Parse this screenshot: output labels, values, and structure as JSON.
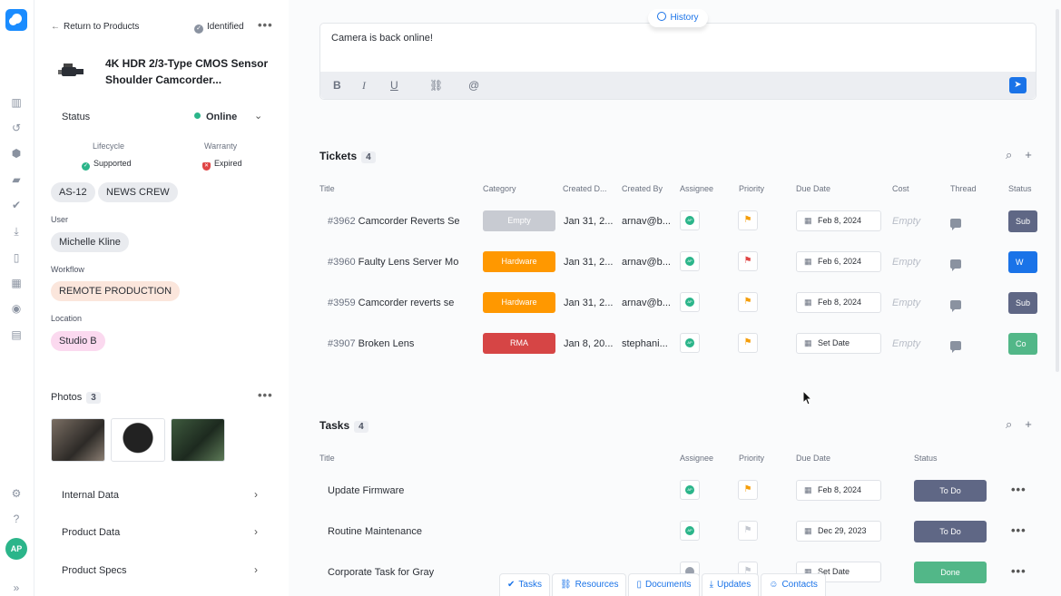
{
  "rail": {
    "avatar": "AP"
  },
  "panel": {
    "back_label": "Return to Products",
    "identified_label": "Identified",
    "product_title": "4K HDR 2/3-Type CMOS Sensor Shoulder Camcorder...",
    "status_label": "Status",
    "status_value": "Online",
    "lifecycle_label": "Lifecycle",
    "lifecycle_value": "Supported",
    "warranty_label": "Warranty",
    "warranty_value": "Expired",
    "tags": [
      "AS-12",
      "NEWS CREW"
    ],
    "user_label": "User",
    "user_value": "Michelle Kline",
    "workflow_label": "Workflow",
    "workflow_value": "REMOTE PRODUCTION",
    "location_label": "Location",
    "location_value": "Studio B",
    "photos_label": "Photos",
    "photos_count": "3",
    "sections": [
      "Internal Data",
      "Product Data",
      "Product Specs"
    ]
  },
  "composer": {
    "history_label": "History",
    "text": "Camera is back online!",
    "toolbar": [
      "B",
      "I",
      "U",
      "link-icon",
      "@"
    ]
  },
  "tickets": {
    "title": "Tickets",
    "count": "4",
    "headers": [
      "Title",
      "Category",
      "Created D...",
      "Created By",
      "Assignee",
      "Priority",
      "Due Date",
      "Cost",
      "Thread",
      "Status"
    ],
    "rows": [
      {
        "id": "#3962",
        "title": "Camcorder Reverts Se",
        "category": "Empty",
        "created": "Jan 31, 2...",
        "by": "arnav@b...",
        "due": "Feb 8, 2024",
        "cost": "Empty",
        "status": "Sub",
        "cat_color": "#c8cbd2",
        "flag_color": "#f59e0b",
        "status_color": "#5f6785"
      },
      {
        "id": "#3960",
        "title": "Faulty Lens Server Mo",
        "category": "Hardware",
        "created": "Jan 31, 2...",
        "by": "arnav@b...",
        "due": "Feb 6, 2024",
        "cost": "Empty",
        "status": "W",
        "cat_color": "#ff9800",
        "flag_color": "#e04545",
        "status_color": "#1a73e8"
      },
      {
        "id": "#3959",
        "title": "Camcorder reverts se",
        "category": "Hardware",
        "created": "Jan 31, 2...",
        "by": "arnav@b...",
        "due": "Feb 8, 2024",
        "cost": "Empty",
        "status": "Sub",
        "cat_color": "#ff9800",
        "flag_color": "#f59e0b",
        "status_color": "#5f6785"
      },
      {
        "id": "#3907",
        "title": "Broken Lens",
        "category": "RMA",
        "created": "Jan 8, 20...",
        "by": "stephani...",
        "due": "Set Date",
        "cost": "Empty",
        "status": "Co",
        "cat_color": "#d64545",
        "flag_color": "#f59e0b",
        "status_color": "#52b788"
      }
    ]
  },
  "tasks": {
    "title": "Tasks",
    "count": "4",
    "headers": [
      "Title",
      "Assignee",
      "Priority",
      "Due Date",
      "Status"
    ],
    "rows": [
      {
        "title": "Update Firmware",
        "due": "Feb 8, 2024",
        "status": "To Do",
        "flag_color": "#f59e0b",
        "status_color": "#5f6785",
        "assigned": true
      },
      {
        "title": "Routine Maintenance",
        "due": "Dec 29, 2023",
        "status": "To Do",
        "flag_color": "#c3c7cf",
        "status_color": "#5f6785",
        "assigned": true
      },
      {
        "title": "Corporate Task for Gray",
        "due": "Set Date",
        "status": "Done",
        "flag_color": "#c3c7cf",
        "status_color": "#52b788",
        "assigned": false
      }
    ]
  },
  "bottom_tabs": [
    "Tasks",
    "Resources",
    "Documents",
    "Updates",
    "Contacts"
  ]
}
